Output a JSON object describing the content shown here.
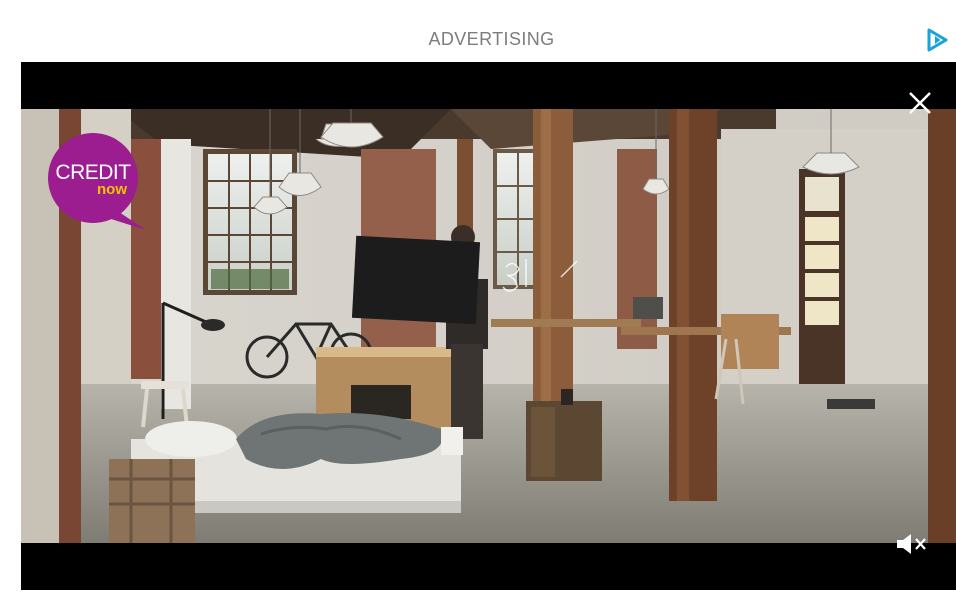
{
  "ad": {
    "label": "ADVERTISING",
    "adchoices_icon": "adchoices-triangle-icon",
    "adchoices_color": "#1aa3d9"
  },
  "player": {
    "close_icon": "close-icon",
    "mute_icon": "speaker-muted-icon",
    "logo": {
      "line1": "CREDIT",
      "line2": "now",
      "bubble_color": "#9b1d8f",
      "accent_color": "#f4c200"
    }
  }
}
